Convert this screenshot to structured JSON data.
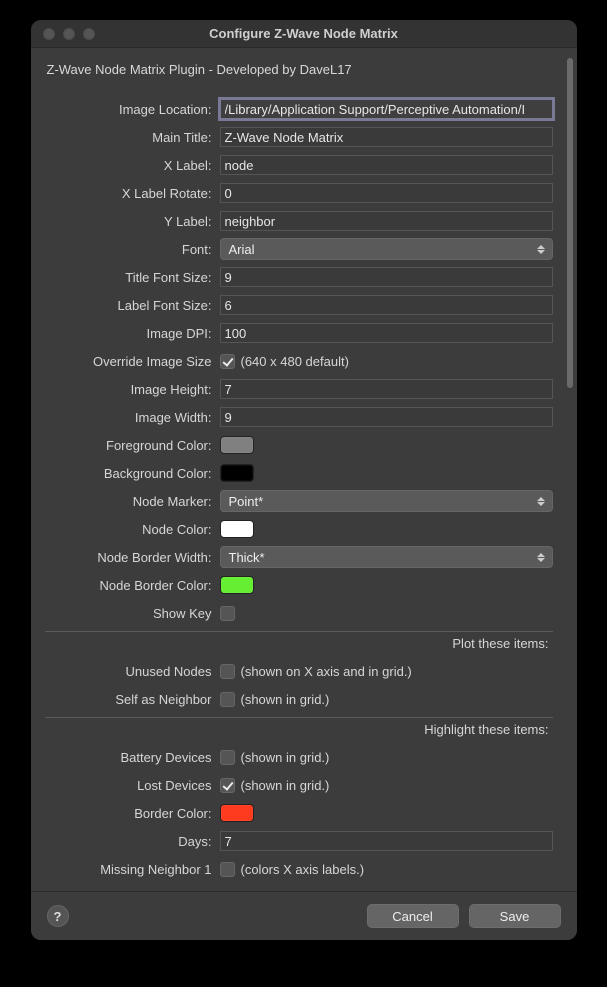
{
  "window": {
    "title": "Configure Z-Wave Node Matrix",
    "subtitle": "Z-Wave Node Matrix Plugin - Developed by DaveL17"
  },
  "fields": {
    "image_location": {
      "label": "Image Location:",
      "value": "/Library/Application Support/Perceptive Automation/I"
    },
    "main_title": {
      "label": "Main Title:",
      "value": "Z-Wave Node Matrix"
    },
    "x_label": {
      "label": "X Label:",
      "value": "node"
    },
    "x_label_rotate": {
      "label": "X Label Rotate:",
      "value": "0"
    },
    "y_label": {
      "label": "Y Label:",
      "value": "neighbor"
    },
    "font": {
      "label": "Font:",
      "value": "Arial"
    },
    "title_font_size": {
      "label": "Title Font Size:",
      "value": "9"
    },
    "label_font_size": {
      "label": "Label Font Size:",
      "value": "6"
    },
    "image_dpi": {
      "label": "Image DPI:",
      "value": "100"
    },
    "override_size": {
      "label": "Override Image Size",
      "checked": true,
      "hint": "(640 x 480 default)"
    },
    "image_height": {
      "label": "Image Height:",
      "value": "7"
    },
    "image_width": {
      "label": "Image Width:",
      "value": "9"
    },
    "foreground_color": {
      "label": "Foreground Color:",
      "hex": "#808080"
    },
    "background_color": {
      "label": "Background Color:",
      "hex": "#000000"
    },
    "node_marker": {
      "label": "Node Marker:",
      "value": "Point*"
    },
    "node_color": {
      "label": "Node Color:",
      "hex": "#ffffff"
    },
    "node_border_width": {
      "label": "Node Border Width:",
      "value": "Thick*"
    },
    "node_border_color": {
      "label": "Node Border Color:",
      "hex": "#66ee33"
    },
    "show_key": {
      "label": "Show Key",
      "checked": false
    }
  },
  "sections": {
    "plot_these": "Plot these items:",
    "highlight_these": "Highlight these items:"
  },
  "plot_items": {
    "unused_nodes": {
      "label": "Unused Nodes",
      "checked": false,
      "hint": "(shown on X axis and in grid.)"
    },
    "self_as_neighbor": {
      "label": "Self as Neighbor",
      "checked": false,
      "hint": "(shown in grid.)"
    }
  },
  "highlight_items": {
    "battery_devices": {
      "label": "Battery Devices",
      "checked": false,
      "hint": "(shown in grid.)"
    },
    "lost_devices": {
      "label": "Lost Devices",
      "checked": true,
      "hint": "(shown in grid.)"
    },
    "border_color": {
      "label": "Border Color:",
      "hex": "#ff3b1f"
    },
    "days": {
      "label": "Days:",
      "value": "7"
    },
    "missing_neighbor_1": {
      "label": "Missing Neighbor 1",
      "checked": false,
      "hint": "(colors X axis labels.)"
    }
  },
  "buttons": {
    "help": "?",
    "cancel": "Cancel",
    "save": "Save"
  }
}
